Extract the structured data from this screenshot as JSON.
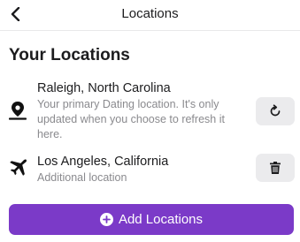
{
  "header": {
    "title": "Locations",
    "back_icon": "chevron-left-icon"
  },
  "section": {
    "title": "Your Locations"
  },
  "locations": [
    {
      "name": "Raleigh, North Carolina",
      "description": "Your primary Dating location. It's only updated when you choose to refresh it here.",
      "icon": "map-pin-icon",
      "action_icon": "refresh-icon"
    },
    {
      "name": "Los Angeles, California",
      "description": "Additional location",
      "icon": "airplane-icon",
      "action_icon": "trash-icon"
    }
  ],
  "add_button": {
    "label": "Add Locations",
    "icon": "plus-circle-icon"
  },
  "colors": {
    "accent": "#7b3ac8",
    "action_bg": "#ebebed",
    "secondary_text": "#8a8a8e"
  }
}
